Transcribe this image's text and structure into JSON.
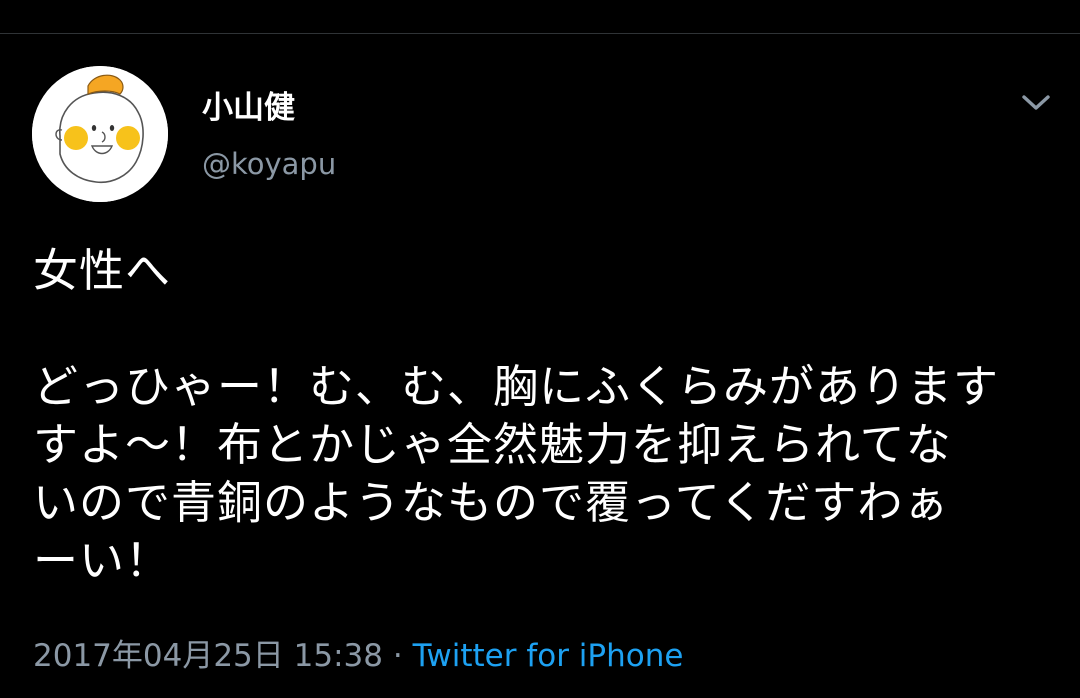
{
  "tweet": {
    "author": {
      "display_name": "小山健",
      "handle": "@koyapu"
    },
    "text": "女性へ\n\nどっひゃー！む、む、胸にふくらみがあります\nすよ〜！布とかじゃ全然魅力を抑えられてな\nいので青銅のようなもので覆ってくだすわぁ\nーい！",
    "timestamp": "2017年04月25日 15:38",
    "separator": "·",
    "source": "Twitter for iPhone"
  },
  "icons": {
    "menu": "chevron-down-icon",
    "avatar": "avatar-illustration"
  },
  "colors": {
    "background": "#000000",
    "text": "#ffffff",
    "secondary_text": "#8b98a5",
    "link": "#1da1f2"
  }
}
